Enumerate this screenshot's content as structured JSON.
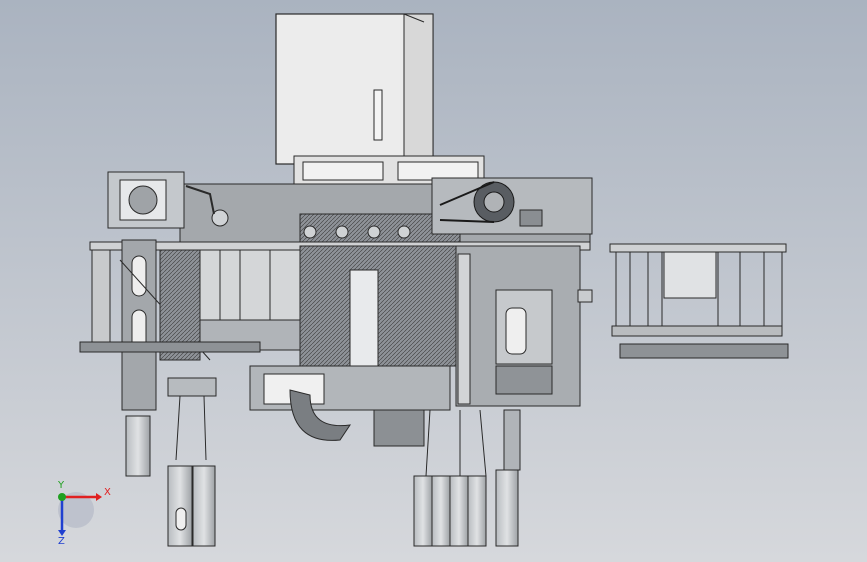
{
  "viewport": {
    "background_top": "#aab3c0",
    "background_bottom": "#d6d8dc",
    "model_color": "#9a9ea4",
    "model_highlight": "#e6e8ea",
    "edge_color": "#2a2a2a"
  },
  "triad": {
    "x_label": "X",
    "y_label": "Y",
    "z_label": "Z",
    "x_color": "#e02020",
    "y_color": "#20a020",
    "z_color": "#2040d0"
  }
}
